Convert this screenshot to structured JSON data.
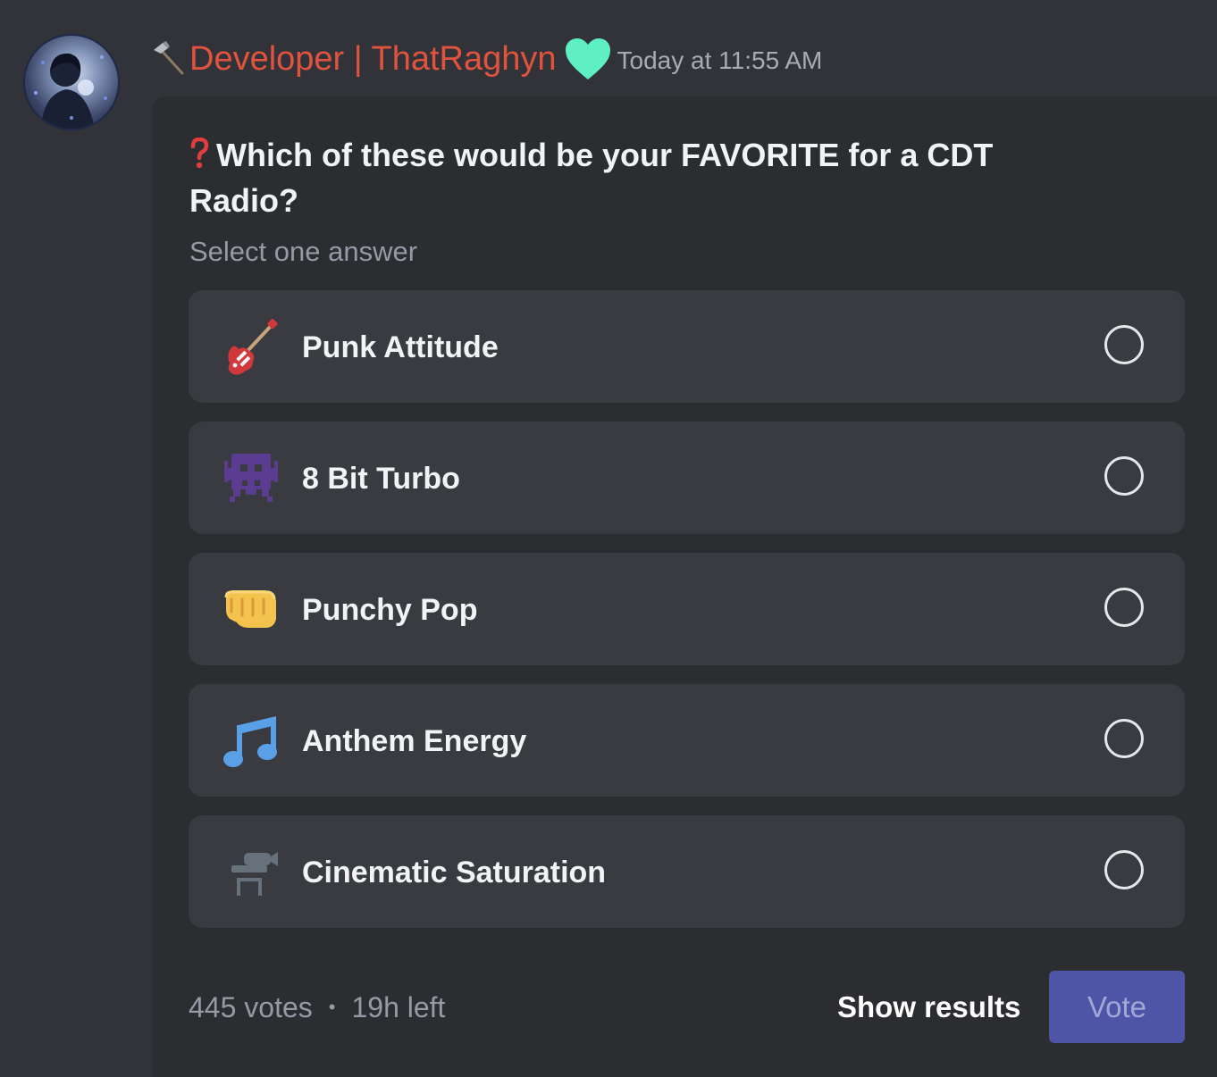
{
  "message": {
    "username": "Developer | ThatRaghyn",
    "timestamp": "Today at 11:55 AM",
    "role_icon": "hammer-icon",
    "badge_icon": "heart-icon",
    "username_color": "#e0533f",
    "badge_color": "#5ef0c2"
  },
  "poll": {
    "question_icon": "question-mark-icon",
    "question": "Which of these would be your FAVORITE for a CDT Radio?",
    "subtitle": "Select one answer",
    "answers": [
      {
        "label": "Punk Attitude",
        "icon": "guitar-icon",
        "selected": false
      },
      {
        "label": "8 Bit Turbo",
        "icon": "space-invader-icon",
        "selected": false
      },
      {
        "label": "Punchy Pop",
        "icon": "fist-icon",
        "selected": false
      },
      {
        "label": "Anthem Energy",
        "icon": "music-notes-icon",
        "selected": false
      },
      {
        "label": "Cinematic Saturation",
        "icon": "movie-camera-icon",
        "selected": false
      }
    ],
    "votes": "445 votes",
    "separator": "•",
    "time_left": "19h left",
    "show_results_label": "Show results",
    "vote_label": "Vote",
    "accent_color": "#4f55a6"
  }
}
